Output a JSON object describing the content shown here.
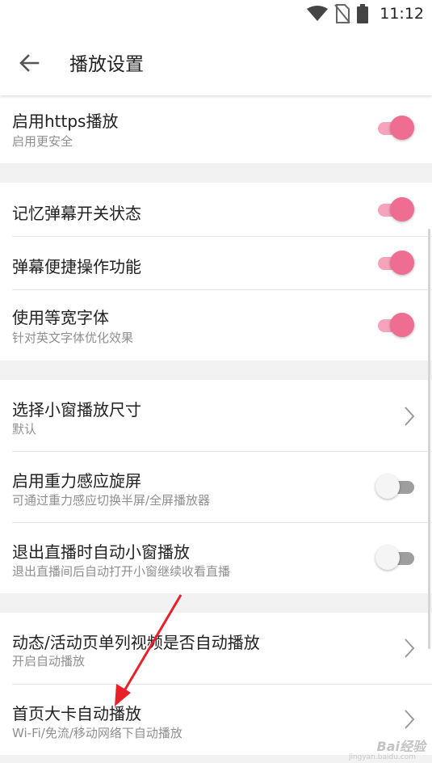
{
  "status_bar": {
    "time": "11:12",
    "icons": [
      "wifi-icon",
      "no-sim-icon",
      "battery-icon"
    ]
  },
  "toolbar": {
    "back_icon": "arrow-left-icon",
    "title": "播放设置"
  },
  "settings": {
    "https": {
      "title": "启用https播放",
      "subtitle": "启用更安全",
      "enabled": true
    },
    "remember_danmaku": {
      "title": "记忆弹幕开关状态",
      "enabled": true
    },
    "danmaku_shortcut": {
      "title": "弹幕便捷操作功能",
      "enabled": true
    },
    "monospace_font": {
      "title": "使用等宽字体",
      "subtitle": "针对英文字体优化效果",
      "enabled": true
    },
    "small_window_size": {
      "title": "选择小窗播放尺寸",
      "subtitle": "默认"
    },
    "gravity_rotate": {
      "title": "启用重力感应旋屏",
      "subtitle": "可通过重力感应切换半屏/全屏播放器",
      "enabled": false
    },
    "live_exit_small_window": {
      "title": "退出直播时自动小窗播放",
      "subtitle": "退出直播间后自动打开小窗继续收看直播",
      "enabled": false
    },
    "feed_autoplay": {
      "title": "动态/活动页单列视频是否自动播放",
      "subtitle": "开启自动播放"
    },
    "home_card_autoplay": {
      "title": "首页大卡自动播放",
      "subtitle": "Wi-Fi/免流/移动网络下自动播放"
    }
  },
  "colors": {
    "accent": "#f06d92",
    "accent_track": "#f6a4bb",
    "annotation_arrow": "#e8202a"
  },
  "watermark": {
    "text": "Bai经验",
    "sub": "jingyan.baidu.com"
  }
}
